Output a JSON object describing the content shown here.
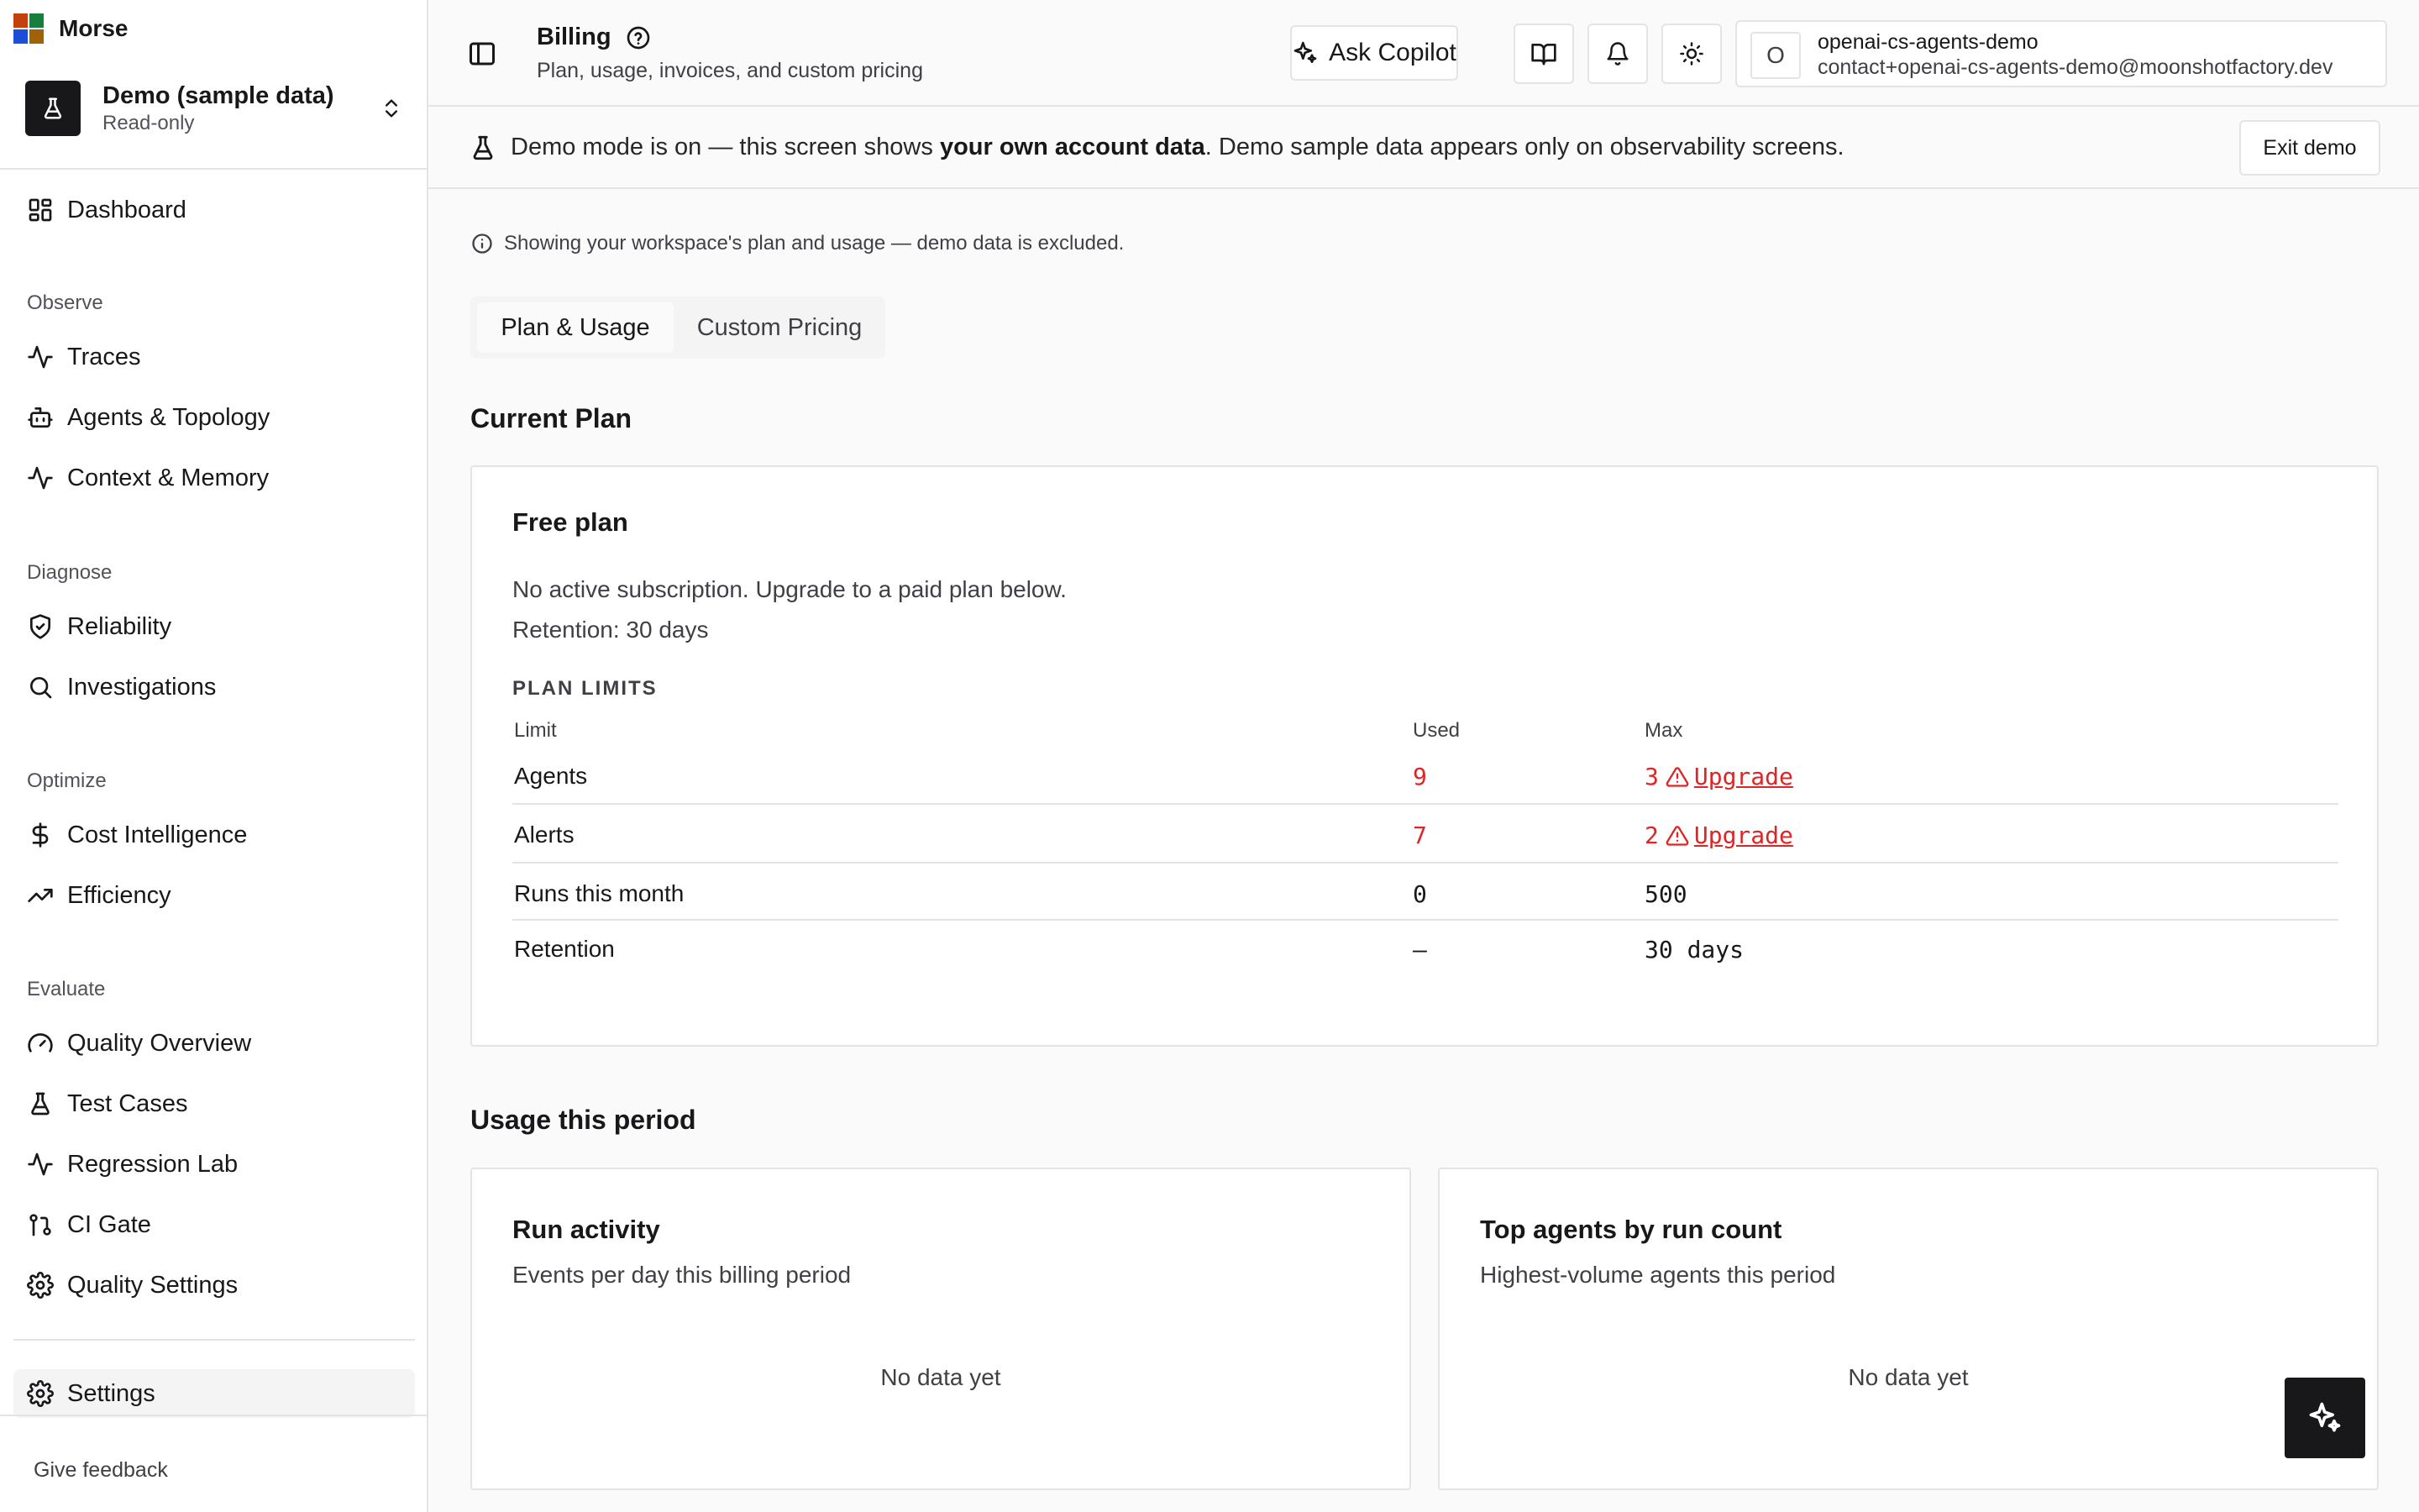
{
  "app": {
    "name": "Morse"
  },
  "workspace": {
    "name": "Demo (sample data)",
    "mode": "Read-only"
  },
  "sidebar": {
    "dashboard": "Dashboard",
    "sections": {
      "observe": "Observe",
      "diagnose": "Diagnose",
      "optimize": "Optimize",
      "evaluate": "Evaluate"
    },
    "items": {
      "traces": "Traces",
      "agents": "Agents & Topology",
      "context": "Context & Memory",
      "reliability": "Reliability",
      "investigations": "Investigations",
      "cost": "Cost Intelligence",
      "efficiency": "Efficiency",
      "quality_overview": "Quality Overview",
      "test_cases": "Test Cases",
      "regression_lab": "Regression Lab",
      "ci_gate": "CI Gate",
      "quality_settings": "Quality Settings",
      "settings": "Settings"
    },
    "feedback": "Give feedback"
  },
  "header": {
    "title": "Billing",
    "subtitle": "Plan, usage, invoices, and custom pricing",
    "copilot_label": "Ask Copilot",
    "user": {
      "initial": "O",
      "name": "openai-cs-agents-demo",
      "email": "contact+openai-cs-agents-demo@moonshotfactory.dev"
    }
  },
  "banner": {
    "prefix": "Demo mode is on — this screen shows ",
    "bold": "your own account data",
    "suffix": ". Demo sample data appears only on observability screens.",
    "exit_label": "Exit demo"
  },
  "main": {
    "info": "Showing your workspace's plan and usage — demo data is excluded.",
    "tabs": [
      "Plan & Usage",
      "Custom Pricing"
    ],
    "current_plan_title": "Current Plan",
    "plan": {
      "name": "Free plan",
      "description": "No active subscription. Upgrade to a paid plan below.",
      "retention": "Retention: 30 days",
      "limits_heading": "PLAN LIMITS",
      "columns": [
        "Limit",
        "Used",
        "Max"
      ],
      "rows": [
        {
          "name": "Agents",
          "used": "9",
          "max": "3",
          "over": true,
          "action": "Upgrade"
        },
        {
          "name": "Alerts",
          "used": "7",
          "max": "2",
          "over": true,
          "action": "Upgrade"
        },
        {
          "name": "Runs this month",
          "used": "0",
          "max": "500",
          "over": false,
          "action": ""
        },
        {
          "name": "Retention",
          "used": "—",
          "max": "30 days",
          "over": false,
          "action": ""
        }
      ]
    },
    "usage_title": "Usage this period",
    "usage_cards": [
      {
        "title": "Run activity",
        "subtitle": "Events per day this billing period",
        "empty": "No data yet"
      },
      {
        "title": "Top agents by run count",
        "subtitle": "Highest-volume agents this period",
        "empty": "No data yet"
      }
    ]
  },
  "colors": {
    "danger": "#dc2626",
    "text": "#18181b",
    "muted": "#3f3f46",
    "border": "#e4e4e7"
  }
}
